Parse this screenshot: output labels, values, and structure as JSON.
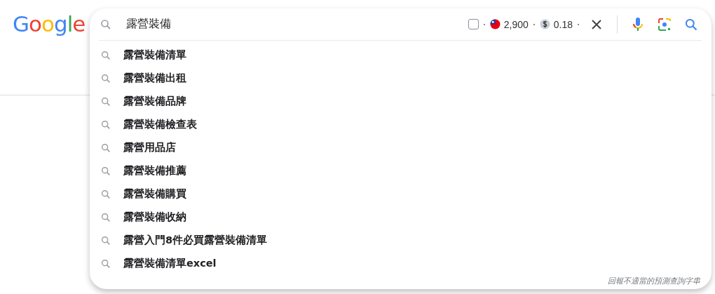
{
  "logo": {
    "text": "Google"
  },
  "search": {
    "value": "露營裝備",
    "badges": {
      "checked": false,
      "volume": "2,900",
      "cpc": "0.18"
    }
  },
  "suggestions": [
    {
      "text": "露營裝備清單"
    },
    {
      "text": "露營裝備出租"
    },
    {
      "text": "露營裝備品牌"
    },
    {
      "text": "露營裝備檢查表"
    },
    {
      "text": "露營用品店"
    },
    {
      "text": "露營裝備推薦"
    },
    {
      "text": "露營裝備購買"
    },
    {
      "text": "露營裝備收納"
    },
    {
      "text": "露營入門8件必買露營裝備清單"
    },
    {
      "text": "露營裝備清單excel"
    }
  ],
  "report_link": "回報不適當的預測查詢字串"
}
